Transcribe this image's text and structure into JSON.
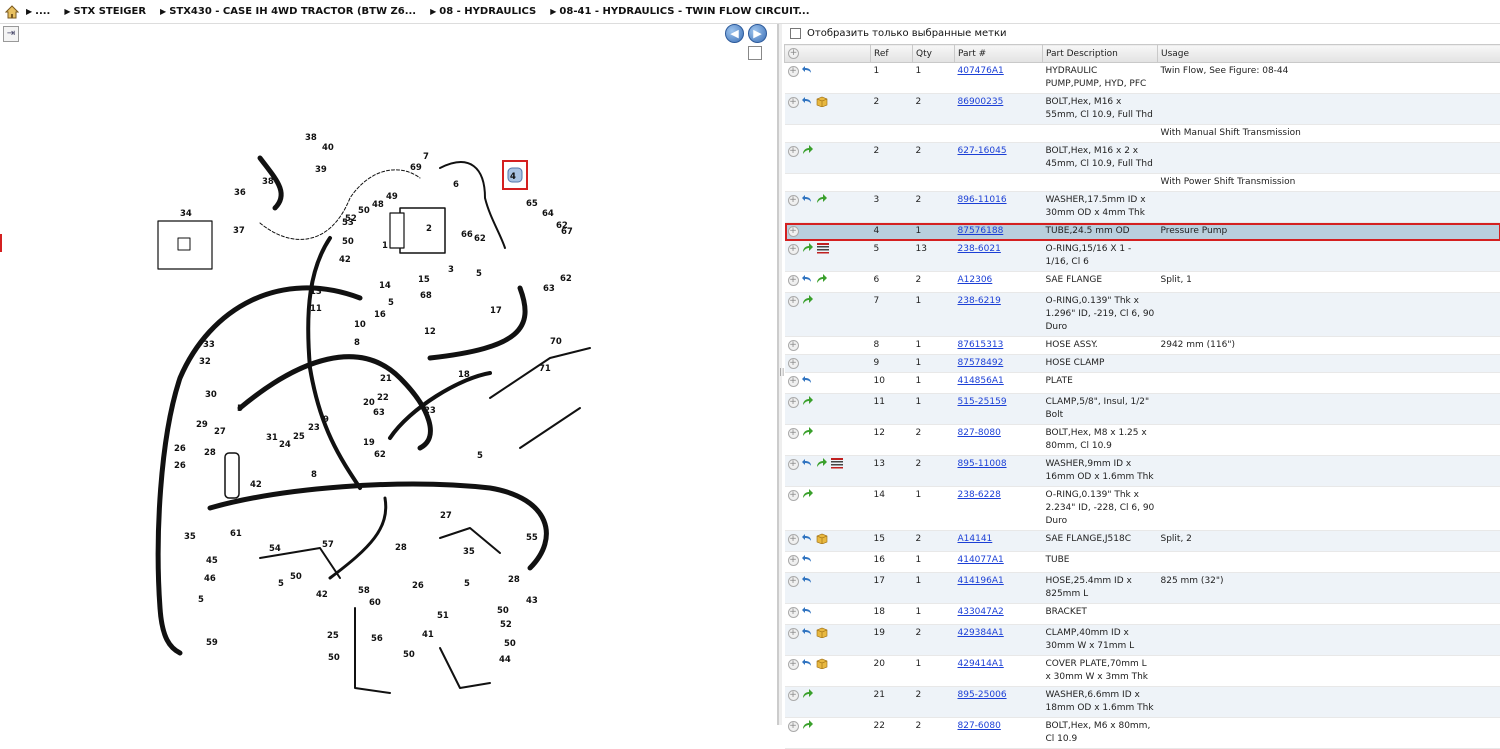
{
  "breadcrumb": {
    "items": [
      "....",
      "STX STEIGER",
      "STX430 - CASE IH 4WD TRACTOR (BTW Z6...",
      "08 - HYDRAULICS",
      "08-41 - HYDRAULICS - TWIN FLOW CIRCUIT..."
    ]
  },
  "left": {
    "nav_prev": "◀",
    "nav_next": "▶",
    "expand": "⇥"
  },
  "diagram": {
    "callouts": [
      "34",
      "38",
      "40",
      "39",
      "36",
      "38",
      "37",
      "7",
      "69",
      "6",
      "4",
      "65",
      "64",
      "62",
      "67",
      "53",
      "50",
      "48",
      "49",
      "52",
      "50",
      "1",
      "2",
      "3",
      "66",
      "62",
      "5",
      "63",
      "62",
      "42",
      "15",
      "14",
      "68",
      "16",
      "5",
      "12",
      "13",
      "11",
      "10",
      "8",
      "17",
      "70",
      "33",
      "32",
      "30",
      "5",
      "29",
      "27",
      "28",
      "24",
      "25",
      "23",
      "9",
      "22",
      "21",
      "20",
      "63",
      "62",
      "19",
      "18",
      "23",
      "71",
      "5",
      "26",
      "26",
      "31",
      "42",
      "8",
      "35",
      "61",
      "27",
      "35",
      "55",
      "54",
      "57",
      "5",
      "50",
      "42",
      "28",
      "26",
      "5",
      "28",
      "43",
      "45",
      "46",
      "5",
      "59",
      "58",
      "60",
      "25",
      "56",
      "50",
      "50",
      "41",
      "51",
      "50",
      "52",
      "50",
      "44"
    ]
  },
  "right": {
    "filter_label": "Отобразить только выбранные метки",
    "columns": [
      "Ref",
      "Qty",
      "Part #",
      "Part Description",
      "Usage"
    ],
    "rows": [
      {
        "type": "row",
        "icons": [
          "back"
        ],
        "ref": "1",
        "qty": "1",
        "part": "407476A1",
        "desc": "HYDRAULIC PUMP,PUMP, HYD, PFC",
        "usage": "Twin Flow, See Figure: 08-44"
      },
      {
        "type": "row",
        "icons": [
          "back",
          "box"
        ],
        "ref": "2",
        "qty": "2",
        "part": "86900235",
        "desc": "BOLT,Hex, M16 x 55mm, Cl 10.9, Full Thd",
        "usage": ""
      },
      {
        "type": "note",
        "usage": "With Manual Shift Transmission"
      },
      {
        "type": "row",
        "icons": [
          "fwd"
        ],
        "ref": "2",
        "qty": "2",
        "part": "627-16045",
        "desc": "BOLT,Hex, M16 x 2 x 45mm, Cl 10.9, Full Thd",
        "usage": ""
      },
      {
        "type": "note",
        "usage": "With Power Shift Transmission"
      },
      {
        "type": "row",
        "icons": [
          "back",
          "fwd"
        ],
        "ref": "3",
        "qty": "2",
        "part": "896-11016",
        "desc": "WASHER,17.5mm ID x 30mm OD x 4mm Thk",
        "usage": ""
      },
      {
        "type": "sel",
        "icons": [],
        "ref": "4",
        "qty": "1",
        "part": "87576188",
        "desc": "TUBE,24.5 mm OD",
        "usage": "Pressure Pump"
      },
      {
        "type": "row",
        "icons": [
          "fwd",
          "list"
        ],
        "ref": "5",
        "qty": "13",
        "part": "238-6021",
        "desc": "O-RING,15/16 X 1 - 1/16, Cl 6",
        "usage": ""
      },
      {
        "type": "row",
        "icons": [
          "back",
          "fwd"
        ],
        "ref": "6",
        "qty": "2",
        "part": "A12306",
        "desc": "SAE FLANGE",
        "usage": "Split, 1"
      },
      {
        "type": "row",
        "icons": [
          "fwd"
        ],
        "ref": "7",
        "qty": "1",
        "part": "238-6219",
        "desc": "O-RING,0.139\" Thk x 1.296\" ID, -219, Cl 6, 90 Duro",
        "usage": ""
      },
      {
        "type": "row",
        "icons": [],
        "ref": "8",
        "qty": "1",
        "part": "87615313",
        "desc": "HOSE ASSY.",
        "usage": "2942 mm (116\")"
      },
      {
        "type": "row",
        "icons": [],
        "ref": "9",
        "qty": "1",
        "part": "87578492",
        "desc": "HOSE CLAMP",
        "usage": ""
      },
      {
        "type": "row",
        "icons": [
          "back"
        ],
        "ref": "10",
        "qty": "1",
        "part": "414856A1",
        "desc": "PLATE",
        "usage": ""
      },
      {
        "type": "row",
        "icons": [
          "fwd"
        ],
        "ref": "11",
        "qty": "1",
        "part": "515-25159",
        "desc": "CLAMP,5/8\", Insul, 1/2\" Bolt",
        "usage": ""
      },
      {
        "type": "row",
        "icons": [
          "fwd"
        ],
        "ref": "12",
        "qty": "2",
        "part": "827-8080",
        "desc": "BOLT,Hex, M8 x 1.25 x 80mm, Cl 10.9",
        "usage": ""
      },
      {
        "type": "row",
        "icons": [
          "back",
          "fwd",
          "list"
        ],
        "ref": "13",
        "qty": "2",
        "part": "895-11008",
        "desc": "WASHER,9mm ID x 16mm OD x 1.6mm Thk",
        "usage": ""
      },
      {
        "type": "row",
        "icons": [
          "fwd"
        ],
        "ref": "14",
        "qty": "1",
        "part": "238-6228",
        "desc": "O-RING,0.139\" Thk x 2.234\" ID, -228, Cl 6, 90 Duro",
        "usage": ""
      },
      {
        "type": "row",
        "icons": [
          "back",
          "box"
        ],
        "ref": "15",
        "qty": "2",
        "part": "A14141",
        "desc": "SAE FLANGE,J518C",
        "usage": "Split, 2"
      },
      {
        "type": "row",
        "icons": [
          "back"
        ],
        "ref": "16",
        "qty": "1",
        "part": "414077A1",
        "desc": "TUBE",
        "usage": ""
      },
      {
        "type": "row",
        "icons": [
          "back"
        ],
        "ref": "17",
        "qty": "1",
        "part": "414196A1",
        "desc": "HOSE,25.4mm ID x 825mm L",
        "usage": "825 mm (32\")"
      },
      {
        "type": "row",
        "icons": [
          "back"
        ],
        "ref": "18",
        "qty": "1",
        "part": "433047A2",
        "desc": "BRACKET",
        "usage": ""
      },
      {
        "type": "row",
        "icons": [
          "back",
          "box"
        ],
        "ref": "19",
        "qty": "2",
        "part": "429384A1",
        "desc": "CLAMP,40mm ID x 30mm W x 71mm L",
        "usage": ""
      },
      {
        "type": "row",
        "icons": [
          "back",
          "box"
        ],
        "ref": "20",
        "qty": "1",
        "part": "429414A1",
        "desc": "COVER PLATE,70mm L x 30mm W x 3mm Thk",
        "usage": ""
      },
      {
        "type": "row",
        "icons": [
          "fwd"
        ],
        "ref": "21",
        "qty": "2",
        "part": "895-25006",
        "desc": "WASHER,6.6mm ID x 18mm OD x 1.6mm Thk",
        "usage": ""
      },
      {
        "type": "row",
        "icons": [
          "fwd"
        ],
        "ref": "22",
        "qty": "2",
        "part": "827-6080",
        "desc": "BOLT,Hex, M6 x 80mm, Cl 10.9",
        "usage": ""
      }
    ]
  }
}
